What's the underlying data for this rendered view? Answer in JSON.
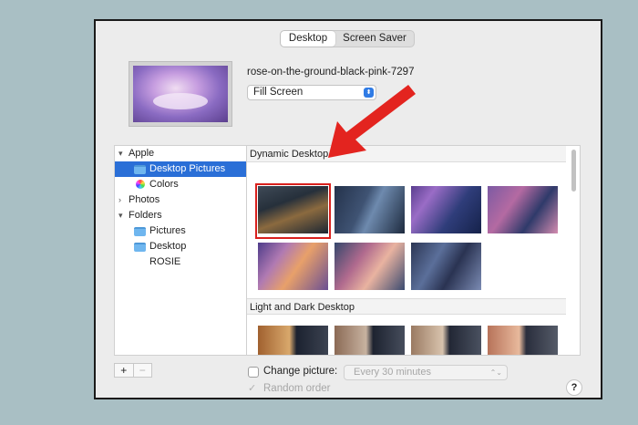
{
  "tabs": {
    "desktop": "Desktop",
    "screen_saver": "Screen Saver"
  },
  "current_image": {
    "name": "rose-on-the-ground-black-pink-7297",
    "fill_mode": "Fill Screen"
  },
  "sidebar": {
    "apple_label": "Apple",
    "desktop_pictures": "Desktop Pictures",
    "colors": "Colors",
    "photos": "Photos",
    "folders_label": "Folders",
    "pictures": "Pictures",
    "desktop": "Desktop",
    "rosie": "ROSIE"
  },
  "sections": {
    "dynamic": "Dynamic Desktop",
    "light_dark": "Light and Dark Desktop"
  },
  "bottom": {
    "plus": "+",
    "minus": "−",
    "change_picture": "Change picture:",
    "interval": "Every 30 minutes",
    "random_order": "Random order",
    "random_check": "✓",
    "help": "?"
  },
  "icons": {
    "disclosure_open": "▾",
    "disclosure_closed": "›",
    "stepper": "⬍",
    "chevron": "⌃⌄"
  },
  "colors": {
    "accent": "#2a6fd7",
    "highlight_box": "#d9201d",
    "arrow": "#e3241f"
  }
}
